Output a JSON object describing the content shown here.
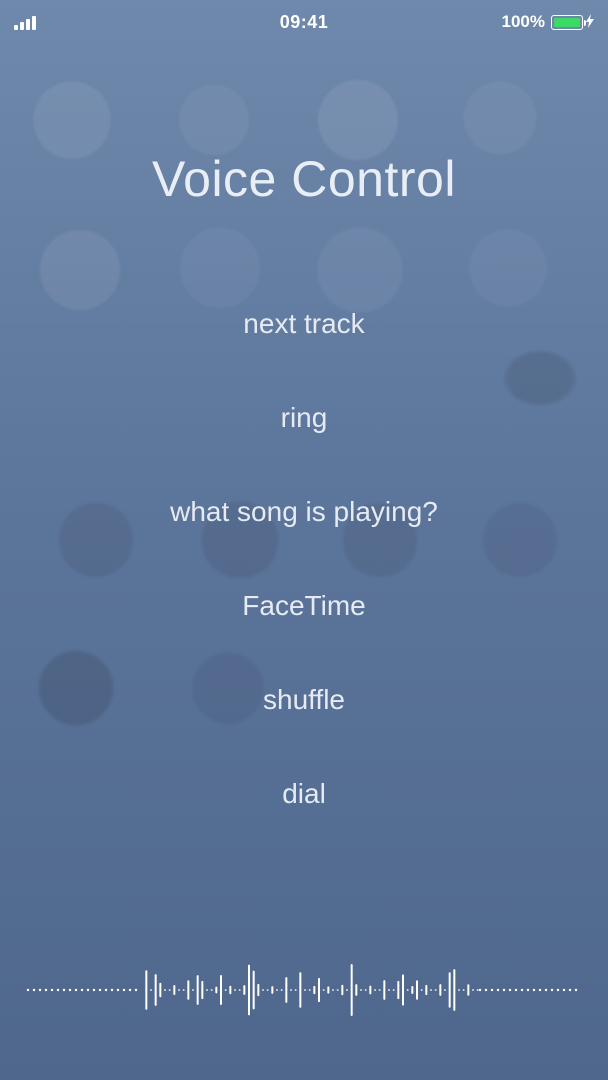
{
  "status_bar": {
    "time": "09:41",
    "battery_percent": "100%"
  },
  "title": "Voice Control",
  "suggestions": [
    "next track",
    "ring",
    "what song is playing?",
    "FaceTime",
    "shuffle",
    "dial"
  ]
}
